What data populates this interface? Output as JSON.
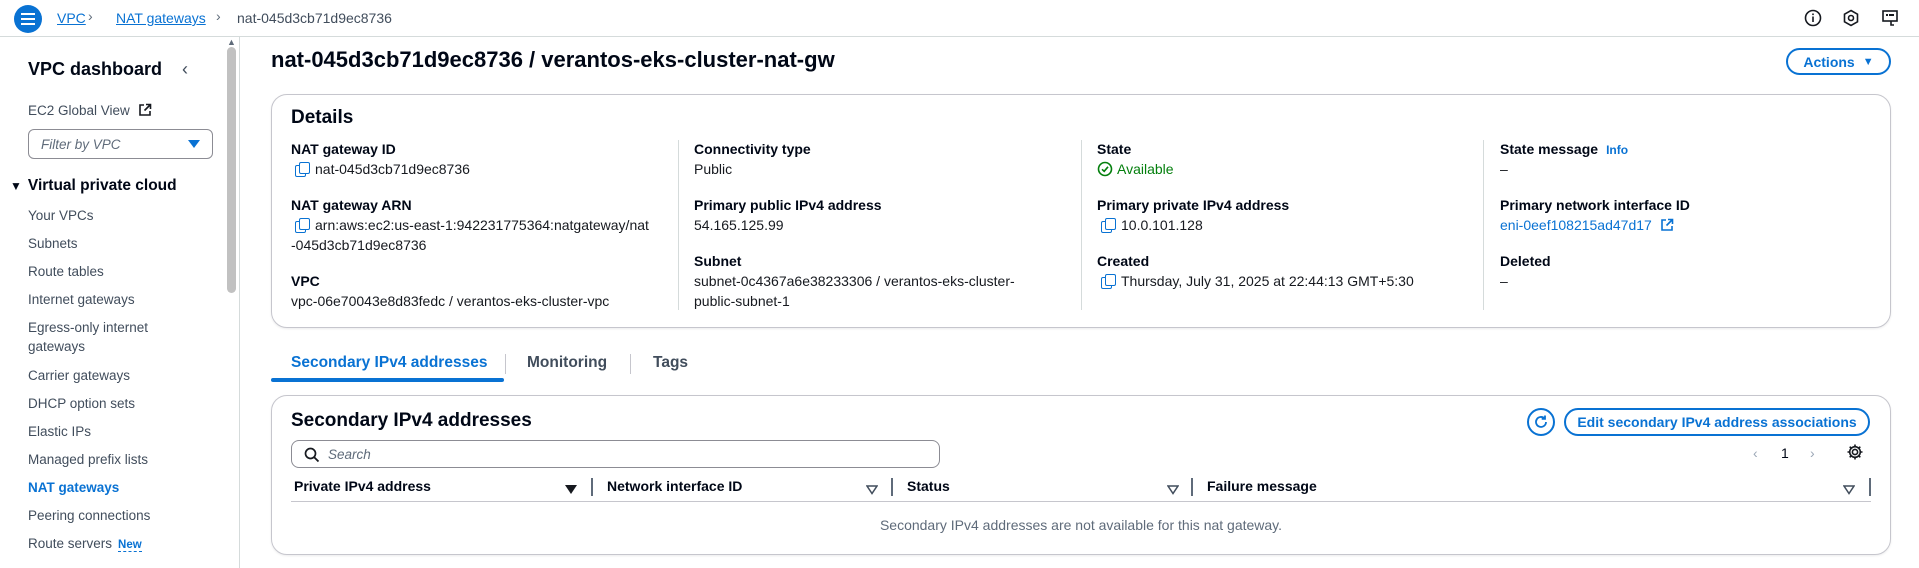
{
  "topbar": {
    "breadcrumbs": [
      "VPC",
      "NAT gateways",
      "nat-045d3cb71d9ec8736"
    ],
    "icons": [
      "info-icon",
      "notifications-icon",
      "feedback-icon"
    ]
  },
  "sidebar": {
    "title": "VPC dashboard",
    "ec2_global_view": "EC2 Global View",
    "filter_placeholder": "Filter by VPC",
    "section": "Virtual private cloud",
    "items": [
      {
        "label": "Your VPCs"
      },
      {
        "label": "Subnets"
      },
      {
        "label": "Route tables"
      },
      {
        "label": "Internet gateways"
      },
      {
        "label": "Egress-only internet gateways"
      },
      {
        "label": "Carrier gateways"
      },
      {
        "label": "DHCP option sets"
      },
      {
        "label": "Elastic IPs"
      },
      {
        "label": "Managed prefix lists"
      },
      {
        "label": "NAT gateways"
      },
      {
        "label": "Peering connections"
      },
      {
        "label": "Route servers",
        "badge": "New"
      }
    ]
  },
  "page": {
    "title": "nat-045d3cb71d9ec8736 / verantos-eks-cluster-nat-gw",
    "actions_label": "Actions"
  },
  "details": {
    "heading": "Details",
    "nat_gateway_id_label": "NAT gateway ID",
    "nat_gateway_id": "nat-045d3cb71d9ec8736",
    "nat_gateway_arn_label": "NAT gateway ARN",
    "nat_gateway_arn_line1": "arn:aws:ec2:us-east-1:942231775364:natgateway/nat",
    "nat_gateway_arn_line2": "-045d3cb71d9ec8736",
    "vpc_label": "VPC",
    "vpc": "vpc-06e70043e8d83fedc / verantos-eks-cluster-vpc",
    "connectivity_type_label": "Connectivity type",
    "connectivity_type": "Public",
    "primary_public_ipv4_label": "Primary public IPv4 address",
    "primary_public_ipv4": "54.165.125.99",
    "subnet_label": "Subnet",
    "subnet_line1": "subnet-0c4367a6e38233306 / verantos-eks-cluster-",
    "subnet_line2": "public-subnet-1",
    "state_label": "State",
    "state": "Available",
    "primary_private_ipv4_label": "Primary private IPv4 address",
    "primary_private_ipv4": "10.0.101.128",
    "created_label": "Created",
    "created": "Thursday, July 31, 2025 at 22:44:13 GMT+5:30",
    "state_message_label": "State message",
    "state_message_info": "Info",
    "state_message": "–",
    "primary_eni_label": "Primary network interface ID",
    "primary_eni": "eni-0eef108215ad47d17",
    "deleted_label": "Deleted",
    "deleted": "–"
  },
  "tabs": [
    "Secondary IPv4 addresses",
    "Monitoring",
    "Tags"
  ],
  "secondary": {
    "heading": "Secondary IPv4 addresses",
    "edit_button": "Edit secondary IPv4 address associations",
    "search_placeholder": "Search",
    "page_number": "1",
    "columns": [
      "Private IPv4 address",
      "Network interface ID",
      "Status",
      "Failure message"
    ],
    "empty_message": "Secondary IPv4 addresses are not available for this nat gateway."
  },
  "colors": {
    "accent": "#0972d3",
    "success": "#037f0c",
    "border": "#c6c6cd"
  }
}
